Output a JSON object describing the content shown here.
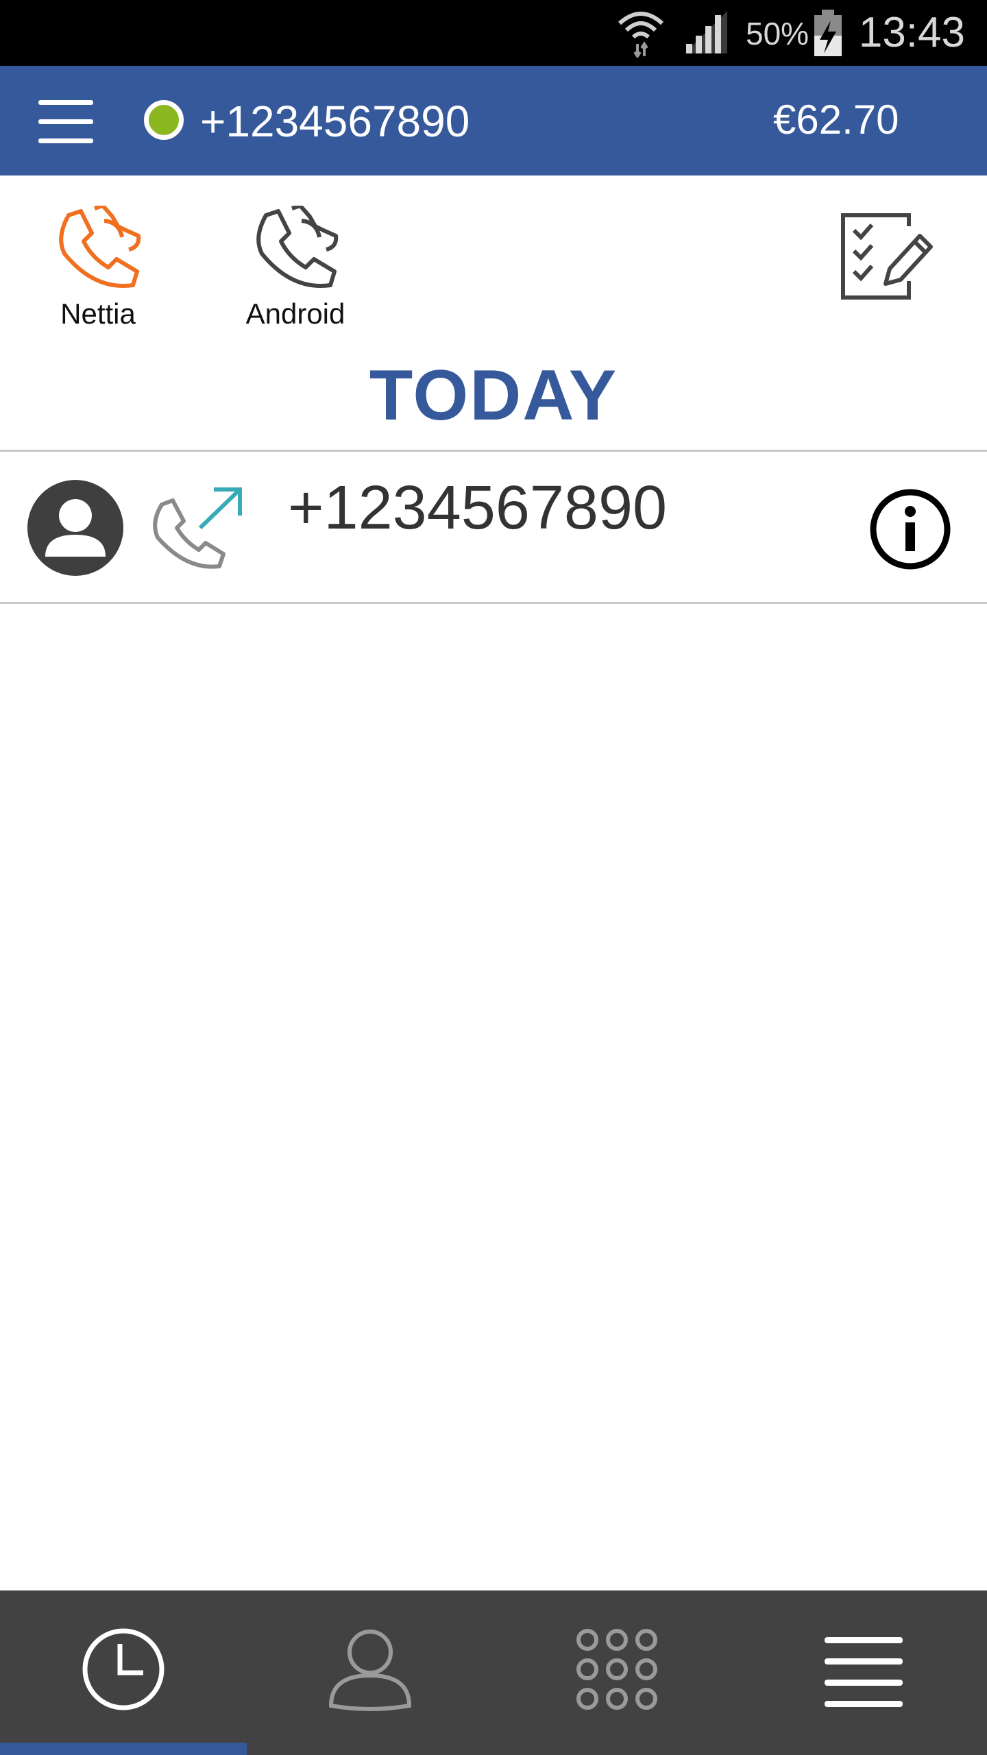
{
  "status_bar": {
    "battery_percent": "50%",
    "time": "13:43"
  },
  "app_bar": {
    "account_number": "+1234567890",
    "status_color": "#8ab81e",
    "balance": "€62.70",
    "color": "#36599b"
  },
  "filters": [
    {
      "label": "Nettia",
      "icon": "phone-icon",
      "color": "#f07020",
      "active": true
    },
    {
      "label": "Android",
      "icon": "phone-icon",
      "color": "#444444",
      "active": false
    }
  ],
  "section_title": "TODAY",
  "call_log": [
    {
      "number": "+1234567890",
      "direction": "outgoing",
      "avatar_icon": "person-icon",
      "info_icon": "info-icon"
    }
  ],
  "bottom_nav": {
    "items": [
      {
        "icon": "clock-icon",
        "selected": true
      },
      {
        "icon": "person-icon",
        "selected": false
      },
      {
        "icon": "dialpad-icon",
        "selected": false
      },
      {
        "icon": "menu-icon",
        "selected": false
      }
    ]
  }
}
